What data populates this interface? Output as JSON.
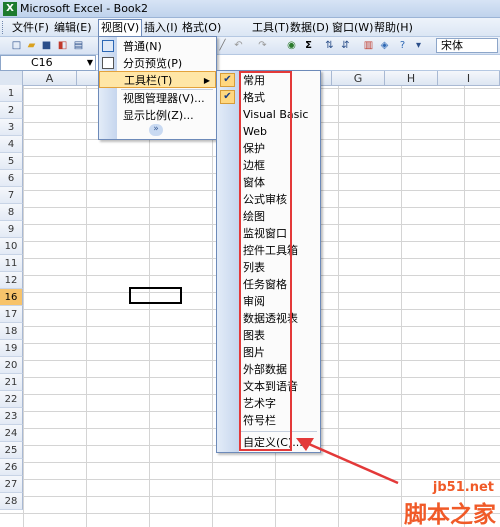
{
  "window": {
    "title": "Microsoft Excel - Book2",
    "app_icon": "X"
  },
  "menubar": {
    "items": [
      {
        "label": "文件(F)"
      },
      {
        "label": "编辑(E)"
      },
      {
        "label": "视图(V)"
      },
      {
        "label": "插入(I)"
      },
      {
        "label": "格式(O)"
      },
      {
        "label": "工具(T)"
      },
      {
        "label": "数据(D)"
      },
      {
        "label": "窗口(W)"
      },
      {
        "label": "帮助(H)"
      }
    ]
  },
  "toolbar": {
    "font_name": "宋体",
    "sum_symbol": "Σ"
  },
  "formula_bar": {
    "name_box": "C16"
  },
  "grid": {
    "columns": [
      "A",
      "B",
      "C",
      "D",
      "E",
      "F",
      "G",
      "H",
      "I"
    ],
    "rows": [
      "1",
      "2",
      "3",
      "4",
      "5",
      "6",
      "7",
      "8",
      "9",
      "10",
      "11",
      "12",
      "13",
      "14",
      "15",
      "16",
      "17",
      "18",
      "19",
      "20",
      "21",
      "22",
      "23",
      "24",
      "25",
      "26",
      "27",
      "28"
    ],
    "selected_row": "16",
    "selected_cell": "C16"
  },
  "view_menu": {
    "items": [
      {
        "label": "普通(N)"
      },
      {
        "label": "分页预览(P)"
      },
      {
        "label": "工具栏(T)"
      },
      {
        "label": "视图管理器(V)..."
      },
      {
        "label": "显示比例(Z)..."
      }
    ],
    "more_glyph": "»"
  },
  "toolbars_submenu": {
    "items": [
      {
        "label": "常用",
        "checked": true
      },
      {
        "label": "格式",
        "checked": true
      },
      {
        "label": "Visual Basic"
      },
      {
        "label": "Web"
      },
      {
        "label": "保护"
      },
      {
        "label": "边框"
      },
      {
        "label": "窗体"
      },
      {
        "label": "公式审核"
      },
      {
        "label": "绘图"
      },
      {
        "label": "监视窗口"
      },
      {
        "label": "控件工具箱"
      },
      {
        "label": "列表"
      },
      {
        "label": "任务窗格"
      },
      {
        "label": "审阅"
      },
      {
        "label": "数据透视表"
      },
      {
        "label": "图表"
      },
      {
        "label": "图片"
      },
      {
        "label": "外部数据"
      },
      {
        "label": "文本到语音"
      },
      {
        "label": "艺术字"
      },
      {
        "label": "符号栏"
      }
    ],
    "customize_label": "自定义(C)...",
    "check_glyph": "✔"
  },
  "annotation_color": "#e33939",
  "watermark": {
    "line1": "jb51.net",
    "line2": "脚本之家"
  }
}
